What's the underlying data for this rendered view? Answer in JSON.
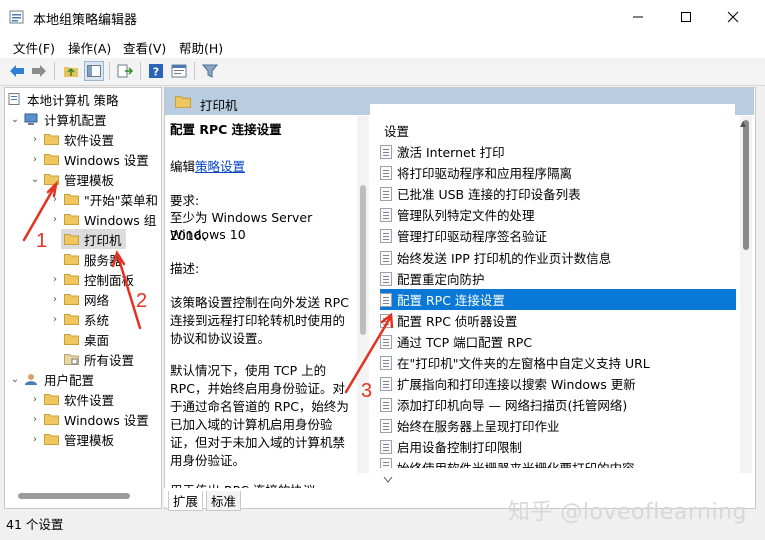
{
  "window": {
    "title": "本地组策略编辑器"
  },
  "menu": [
    "文件(F)",
    "操作(A)",
    "查看(V)",
    "帮助(H)"
  ],
  "tree": {
    "root": "本地计算机 策略",
    "computer_config": "计算机配置",
    "software_settings": "软件设置",
    "windows_settings": "Windows 设置",
    "admin_templates": "管理模板",
    "start_menu": "\"开始\"菜单和",
    "windows_components": "Windows 组",
    "printers": "打印机",
    "server": "服务器",
    "control_panel": "控制面板",
    "network": "网络",
    "system": "系统",
    "desktop": "桌面",
    "all_settings": "所有设置",
    "user_config": "用户配置",
    "user_software": "软件设置",
    "user_windows": "Windows 设置",
    "user_admin": "管理模板"
  },
  "header": {
    "title": "打印机"
  },
  "description": {
    "policy_title": "配置 RPC 连接设置",
    "edit_prefix": "编辑",
    "edit_link": "策略设置",
    "requirements_label": "要求:",
    "requirements_line1": "至少为 Windows Server 2016、",
    "requirements_line2": "Windows 10",
    "desc_label": "描述:",
    "desc_p1": "该策略设置控制在向外发送 RPC 连接到远程打印轮转机时使用的协议和协议设置。",
    "desc_p2": "默认情况下，使用 TCP 上的 RPC，并始终启用身份验证。对于通过命名管道的 RPC，始终为已加入域的计算机启用身份验证，但对于未加入域的计算机禁用身份验证。",
    "desc_p3": "用于传出 RPC 连接的协议"
  },
  "list": {
    "header": "设置",
    "items": [
      "激活 Internet 打印",
      "将打印驱动程序和应用程序隔离",
      "已批准 USB 连接的打印设备列表",
      "管理队列特定文件的处理",
      "管理打印驱动程序签名验证",
      "始终发送 IPP 打印机的作业页计数信息",
      "配置重定向防护",
      "配置 RPC 连接设置",
      "配置 RPC 侦听器设置",
      "通过 TCP 端口配置 RPC",
      "在\"打印机\"文件夹的左窗格中自定义支持 URL",
      "扩展指向和打印连接以搜索 Windows 更新",
      "添加打印机向导 — 网络扫描页(托管网络)",
      "始终在服务器上呈现打印作业",
      "启用设备控制打印限制",
      "始终使用软件光栅器来光栅化要打印的内容"
    ],
    "selected_index": 7
  },
  "tabs": [
    "扩展",
    "标准"
  ],
  "status": "41 个设置",
  "watermark": "知乎 @loveoflearning",
  "annotations": [
    "1",
    "2",
    "3"
  ],
  "colors": {
    "selection": "#0a78d7",
    "header_band": "#b9cde0",
    "annotation": "#e53220",
    "link": "#0645c8"
  }
}
